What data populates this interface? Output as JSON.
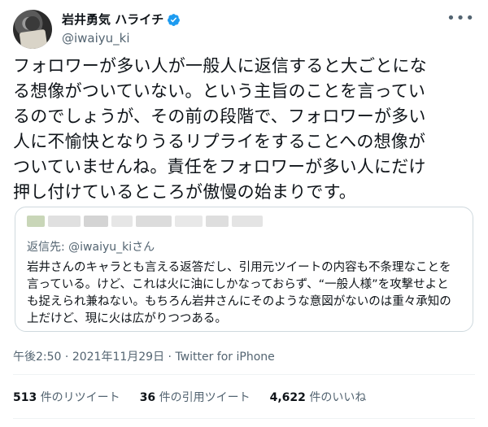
{
  "author": {
    "name": "岩井勇気 ハライチ",
    "handle": "@iwaiyu_ki",
    "verified": true,
    "verified_icon": "verified-badge-icon",
    "more_icon": "more-horizontal-icon"
  },
  "tweet": {
    "lines": [
      "フォロワーが多い人が一般人に返信すると大ごとにな",
      "る想像がついていない。という主旨のことを言ってい",
      "るのでしょうが、その前の段階で、フォロワーが多い",
      "人に不愉快となりうるリプライをすることへの想像が",
      "ついていませんね。責任をフォロワーが多い人にだけ",
      "押し付けているところが傲慢の始まりです。"
    ]
  },
  "quoted": {
    "reply_prefix": "返信先:",
    "reply_handle": "@iwaiyu_kiさん",
    "lines": [
      "岩井さんのキャラとも言える返答だし、引用元ツイートの内容も不条理なことを",
      "言っている。けど、これは火に油にしかなっておらず、“一般人様”を攻撃せよと",
      "も捉えられ兼ねない。もちろん岩井さんにそのような意図がないのは重々承知の",
      "上だけど、現に火は広がりつつある。"
    ]
  },
  "meta": {
    "time": "午後2:50",
    "date": "2021年11月29日",
    "separator": "·",
    "source": "Twitter for iPhone"
  },
  "stats": {
    "retweets": "513",
    "retweets_label": "件のリツイート",
    "quotes": "36",
    "quotes_label": "件の引用ツイート",
    "likes": "4,622",
    "likes_label": "件のいいね"
  },
  "colors": {
    "text": "#0f1419",
    "secondary": "#536471",
    "verified": "#1d9bf0",
    "border": "#cfd9de"
  }
}
